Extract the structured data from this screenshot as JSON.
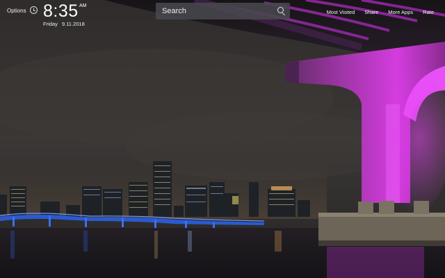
{
  "header": {
    "options_label": "Options",
    "clock_icon": "clock-icon",
    "time": "8:35",
    "ampm": "AM",
    "day": "Friday",
    "date": "9.11.2018"
  },
  "search": {
    "placeholder": "Search",
    "icon": "search-icon"
  },
  "nav": {
    "items": [
      {
        "label": "Most Visited"
      },
      {
        "label": "Share"
      },
      {
        "label": "More Apps"
      },
      {
        "label": "Rate"
      }
    ]
  },
  "background": {
    "sky_color": "#2b2929",
    "water_color": "#1c1a1d",
    "bridge_light_color": "#c030c8",
    "skyline_glow_color": "#3a7de0"
  }
}
